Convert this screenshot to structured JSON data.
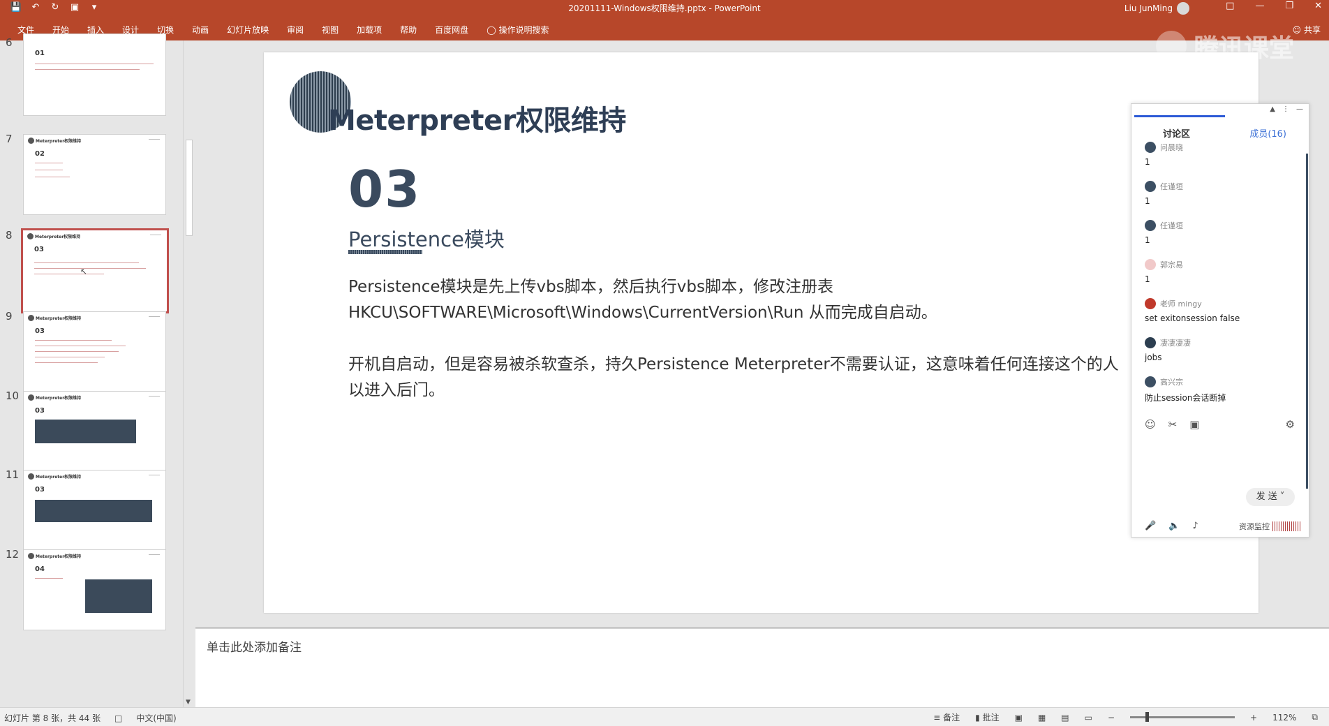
{
  "titlebar": {
    "doc_title": "20201111-Windows权限维持.pptx  -  PowerPoint",
    "user": "Liu JunMing"
  },
  "ribbon": {
    "tabs": [
      "文件",
      "开始",
      "插入",
      "设计",
      "切换",
      "动画",
      "幻灯片放映",
      "审阅",
      "视图",
      "加载项",
      "帮助",
      "百度网盘",
      "操作说明搜索"
    ],
    "share": "共享",
    "watermark": "腾讯课堂"
  },
  "thumbnails": [
    {
      "num": "6",
      "section": "01"
    },
    {
      "num": "7",
      "section": "02"
    },
    {
      "num": "8",
      "section": "03"
    },
    {
      "num": "9",
      "section": "03"
    },
    {
      "num": "10",
      "section": "03"
    },
    {
      "num": "11",
      "section": "03"
    },
    {
      "num": "12",
      "section": "04"
    }
  ],
  "thumb_header": "Meterpreter权限维持",
  "slide": {
    "title": "Meterpreter权限维持",
    "number": "03",
    "subtitle": "Persistence模块",
    "para1_line1": "Persistence模块是先上传vbs脚本，然后执行vbs脚本，修改注册表",
    "para1_line2": "HKCU\\SOFTWARE\\Microsoft\\Windows\\CurrentVersion\\Run 从而完成自启动。",
    "para2_line1": "开机自启动，但是容易被杀软查杀，持久Persistence Meterpreter不需要认证，这意味着任何连接这个的人",
    "para2_line2": "以进入后门。"
  },
  "notes": {
    "placeholder": "单击此处添加备注"
  },
  "statusbar": {
    "slide_info": "幻灯片 第 8 张，共 44 张",
    "language": "中文(中国)",
    "notes_btn": "备注",
    "comments_btn": "批注",
    "zoom": "112%"
  },
  "chat": {
    "tab_discussion": "讨论区",
    "tab_members": "成员(16)",
    "messages": [
      {
        "who": "问晨晓",
        "body": "1"
      },
      {
        "who": "任谨垣",
        "body": "1"
      },
      {
        "who": "任谨垣",
        "body": "1"
      },
      {
        "who": "郭宗易",
        "body": "1"
      },
      {
        "who": "老师 mingy",
        "body": "set exitonsession false"
      },
      {
        "who": "凄凄凄凄",
        "body": "jobs"
      },
      {
        "who": "高兴宗",
        "body": "防止session会话断掉"
      }
    ],
    "send_label": "发 送",
    "resource_label": "资源监控"
  },
  "colors": {
    "accent": "#b7472a",
    "title_color": "#2e3e55",
    "selected_thumb_border": "#c0504d"
  }
}
